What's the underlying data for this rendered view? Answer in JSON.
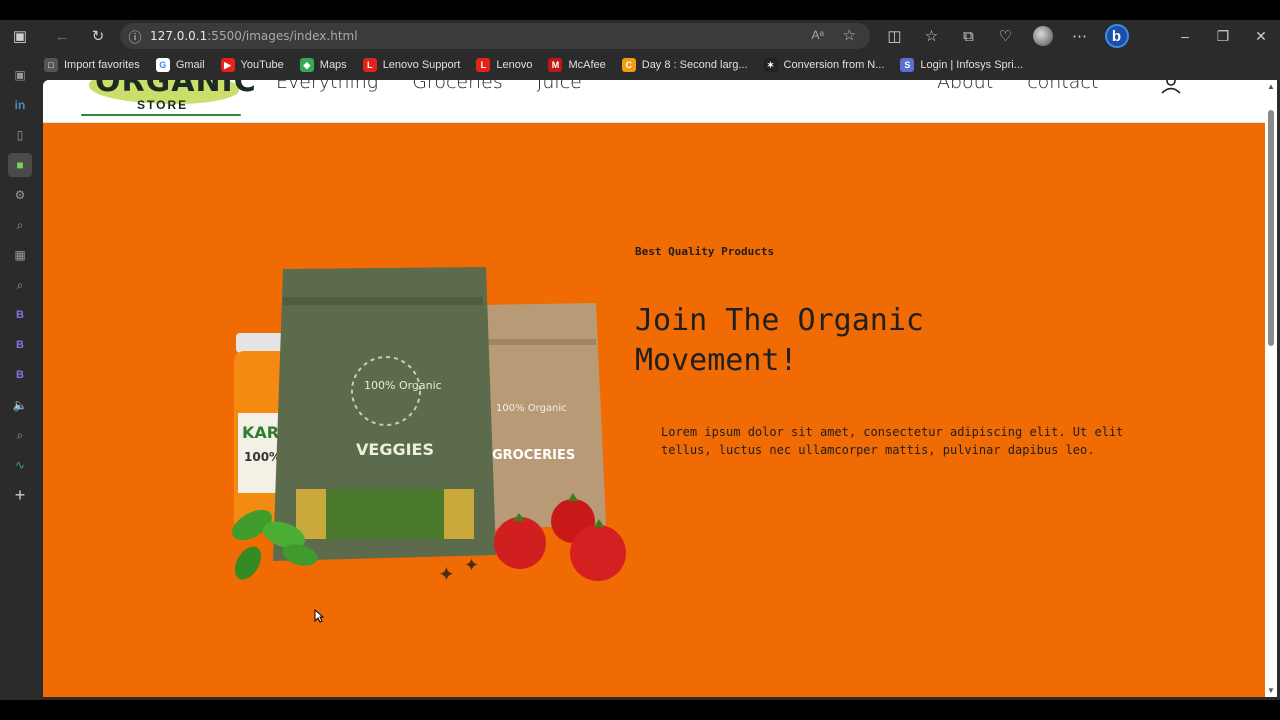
{
  "browser": {
    "url_host": "127.0.0.1",
    "url_rest": ":5500/images/index.html",
    "read_aloud_label": "Aᵃ"
  },
  "bookmarks": [
    {
      "label": "Import favorites",
      "color": "#555555",
      "glyph": "□"
    },
    {
      "label": "Gmail",
      "color": "#ffffff",
      "glyph": "G"
    },
    {
      "label": "YouTube",
      "color": "#e62117",
      "glyph": "▶"
    },
    {
      "label": "Maps",
      "color": "#34a853",
      "glyph": "◆"
    },
    {
      "label": "Lenovo Support",
      "color": "#e2231a",
      "glyph": "L"
    },
    {
      "label": "Lenovo",
      "color": "#e2231a",
      "glyph": "L"
    },
    {
      "label": "McAfee",
      "color": "#c01818",
      "glyph": "M"
    },
    {
      "label": "Day 8 : Second larg...",
      "color": "#f39c12",
      "glyph": "C"
    },
    {
      "label": "Conversion from N...",
      "color": "#222222",
      "glyph": "✶"
    },
    {
      "label": "Login | Infosys Spri...",
      "color": "#5b6fd6",
      "glyph": "S"
    }
  ],
  "sidebar": {
    "items": [
      {
        "name": "sidebar-tabs-icon",
        "glyph": "▣"
      },
      {
        "name": "sidebar-linkedin-icon",
        "glyph": "in"
      },
      {
        "name": "sidebar-document-icon",
        "glyph": "▯"
      },
      {
        "name": "sidebar-app-icon",
        "glyph": "■"
      },
      {
        "name": "sidebar-app-icon-2",
        "glyph": "⚙"
      },
      {
        "name": "sidebar-app-icon-3",
        "glyph": "⌕"
      },
      {
        "name": "sidebar-app-icon-4",
        "glyph": "▦"
      },
      {
        "name": "sidebar-app-icon-5",
        "glyph": "⌕"
      },
      {
        "name": "sidebar-b-icon-1",
        "glyph": "B"
      },
      {
        "name": "sidebar-b-icon-2",
        "glyph": "B"
      },
      {
        "name": "sidebar-b-icon-3",
        "glyph": "B"
      },
      {
        "name": "sidebar-speaker-icon",
        "glyph": "🔈"
      },
      {
        "name": "sidebar-search-icon",
        "glyph": "⌕"
      },
      {
        "name": "sidebar-chart-icon",
        "glyph": "∿"
      },
      {
        "name": "sidebar-add-icon",
        "glyph": "+"
      }
    ]
  },
  "site": {
    "logo_word": "ORGANIC",
    "logo_sub": "STORE",
    "nav_left": [
      "Everything",
      "Groceries",
      "Juice"
    ],
    "nav_right": [
      "About",
      "contact"
    ],
    "accent_color": "#f06b04"
  },
  "hero": {
    "tag": "Best Quality Products",
    "title": "Join The Organic Movement!",
    "text": "Lorem ipsum dolor sit amet, consectetur adipiscing elit. Ut elit tellus, luctus nec ullamcorper mattis, pulvinar dapibus leo.",
    "bag_veggies_badge": "100% Organic",
    "bag_veggies_label": "VEGGIES",
    "bag_groceries_badge": "100% Organic",
    "bag_groceries_label": "GROCERIES",
    "jar_label": "KAR",
    "jar_sub": "100%"
  }
}
